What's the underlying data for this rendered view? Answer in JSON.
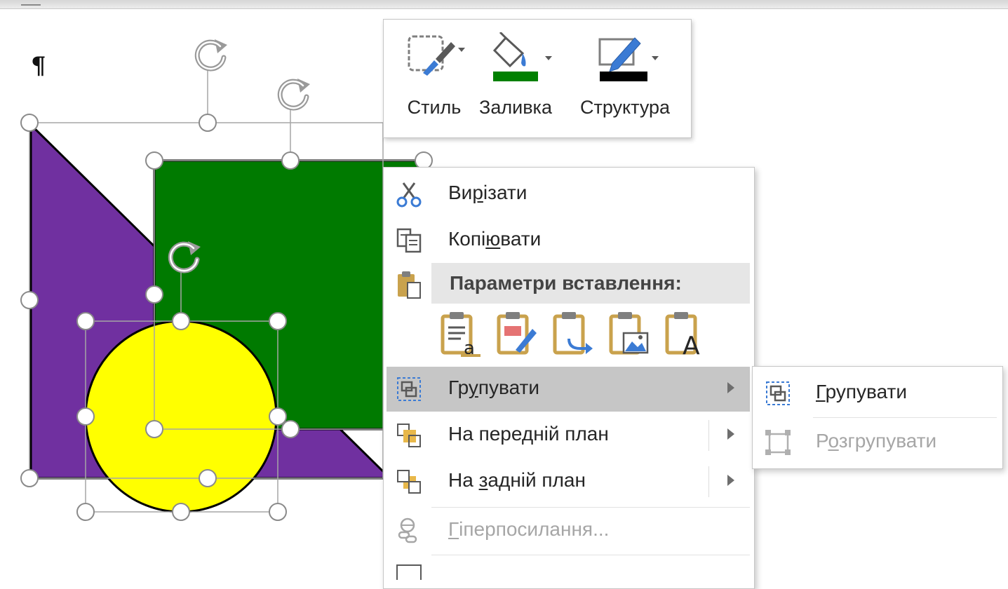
{
  "document": {
    "pilcrow": "¶"
  },
  "shapes": {
    "colors": {
      "triangle": "#7030a0",
      "rectangle": "#007a00",
      "circle": "#ffff00",
      "outline": "#000000",
      "handle": "#ffffff"
    }
  },
  "mini_toolbar": {
    "style_label": "Стиль",
    "fill_label": "Заливка",
    "outline_label": "Структура",
    "fill_color": "#008000",
    "outline_color": "#000000",
    "icons": [
      "shape-style-icon",
      "paint-bucket-icon",
      "pen-outline-icon"
    ]
  },
  "context_menu": {
    "cut": {
      "label_pre": "Ви",
      "label_key": "р",
      "label_post": "ізати",
      "icon": "scissors-icon"
    },
    "copy": {
      "label_pre": "Копі",
      "label_key": "ю",
      "label_post": "вати",
      "icon": "copy-icon"
    },
    "paste_options": {
      "label": "Параметри вставлення:",
      "icon": "clipboard-icon"
    },
    "paste_icons": [
      "paste-keep-source-icon",
      "paste-merge-format-icon",
      "paste-picture-link-icon",
      "paste-picture-icon",
      "paste-text-only-icon"
    ],
    "group": {
      "label_pre": "Гр",
      "label_key": "у",
      "label_post": "пувати",
      "icon": "group-icon",
      "has_submenu": true
    },
    "bring_forward": {
      "label_pre": "На пере",
      "label_key": "д",
      "label_post": "ній план",
      "icon": "bring-forward-icon",
      "has_submenu": true
    },
    "send_backward": {
      "label_pre": "На ",
      "label_key": "з",
      "label_post": "адній план",
      "icon": "send-backward-icon",
      "has_submenu": true
    },
    "hyperlink": {
      "label_pre": "",
      "label_key": "Г",
      "label_post": "іперпосилання...",
      "icon": "hyperlink-icon",
      "disabled": true
    }
  },
  "submenu": {
    "group": {
      "label_pre": "",
      "label_key": "Г",
      "label_post": "рупувати",
      "icon": "group-icon"
    },
    "ungroup": {
      "label_pre": "Р",
      "label_key": "о",
      "label_post": "згрупувати",
      "icon": "ungroup-icon",
      "disabled": true
    }
  }
}
